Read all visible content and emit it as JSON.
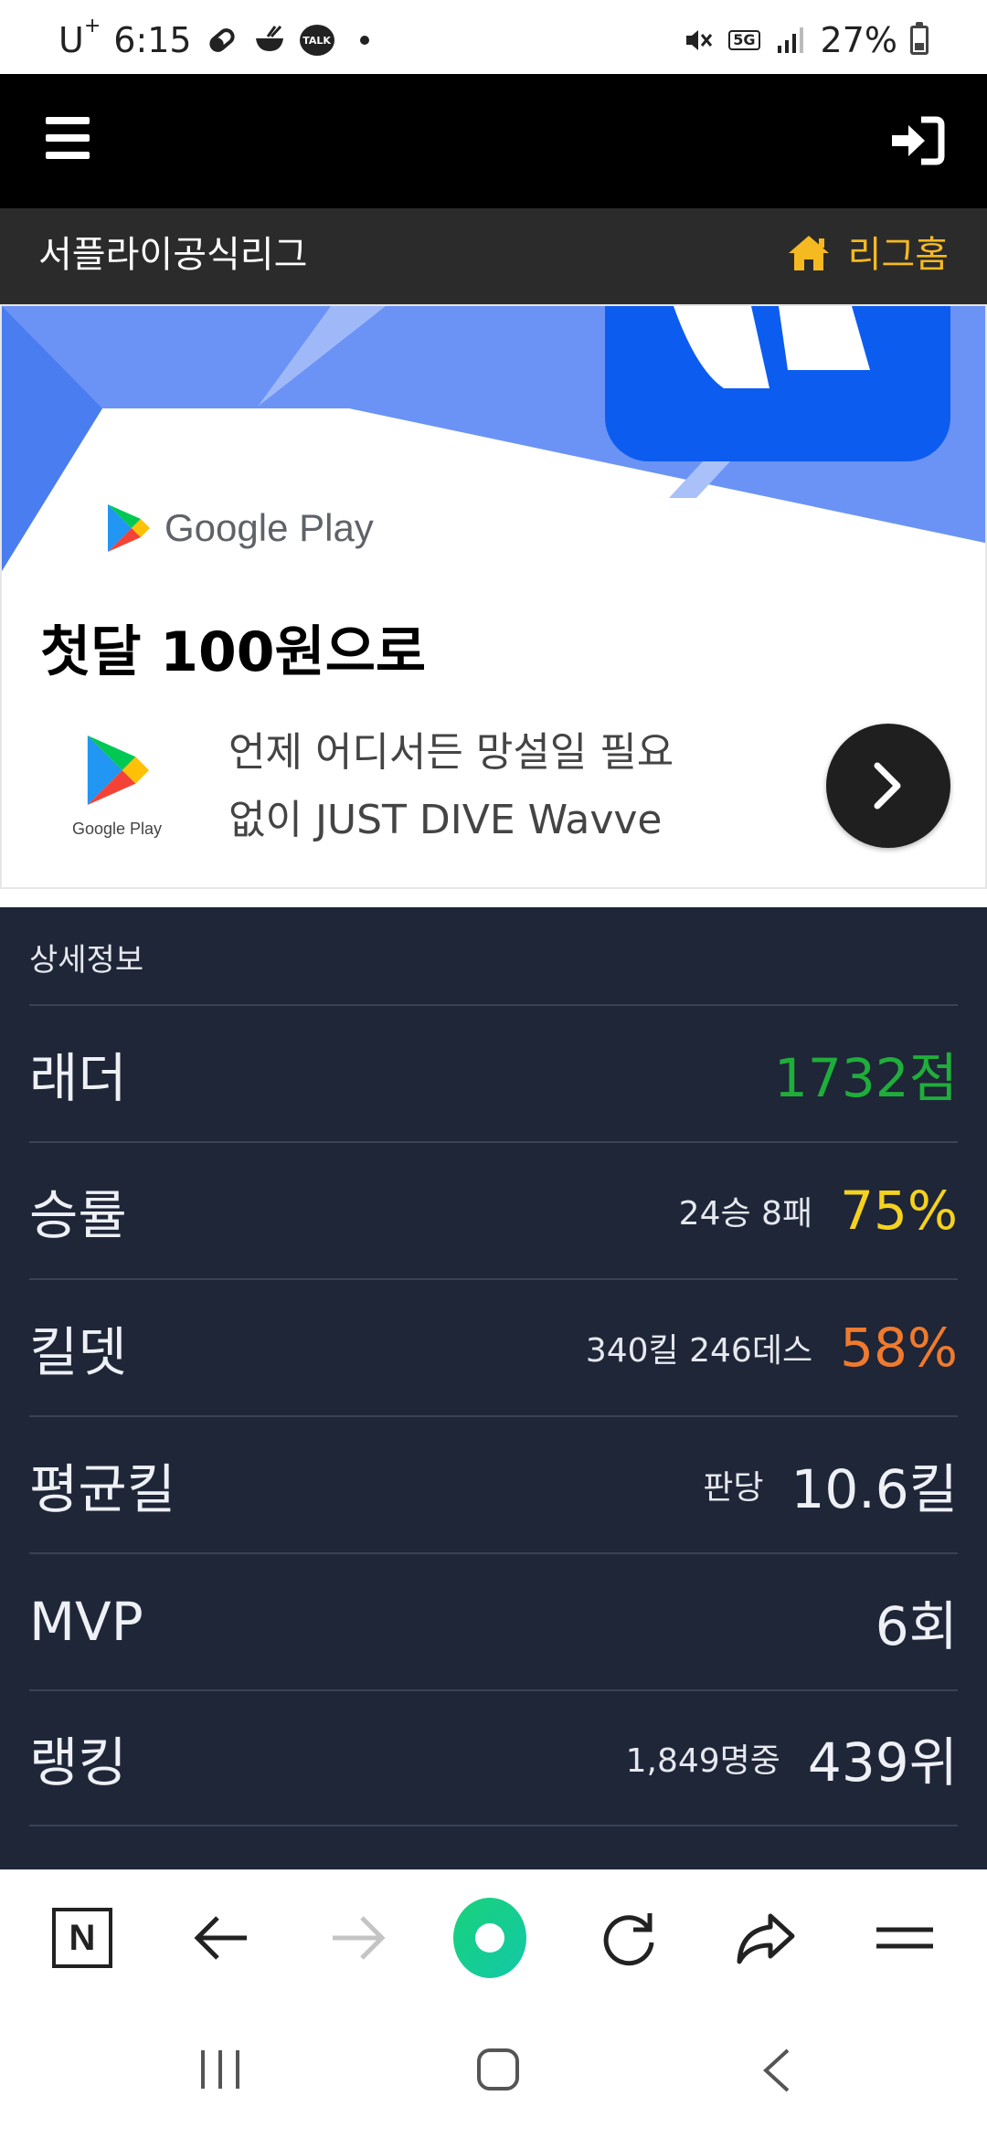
{
  "status_bar": {
    "carrier": "U",
    "carrier_sup": "+",
    "time": "6:15",
    "talk_badge": "TALK",
    "network": "5G",
    "battery": "27%"
  },
  "top_nav": {
    "menu_icon": "hamburger-icon",
    "login_icon": "sign-in-icon"
  },
  "league_bar": {
    "name": "서플라이공식리그",
    "home_label": "리그홈",
    "home_icon": "home-icon",
    "accent": "#f5b921"
  },
  "ad": {
    "store_name": "Google Play",
    "headline": "첫달 100원으로",
    "small_store_name": "Google Play",
    "description_line1": "언제 어디서든 망설일 필요",
    "description_line2": "없이 JUST DIVE Wavve",
    "next_icon": "chevron-right-icon"
  },
  "details": {
    "title": "상세정보",
    "rows": [
      {
        "label": "래더",
        "sub": "",
        "value": "1732점",
        "color": "#1fae3a"
      },
      {
        "label": "승률",
        "sub": "24승 8패",
        "value": "75%",
        "color": "#f5d21e"
      },
      {
        "label": "킬뎃",
        "sub": "340킬 246데스",
        "value": "58%",
        "color": "#f07a2e"
      },
      {
        "label": "평균킬",
        "sub": "판당",
        "value": "10.6킬",
        "color": "#eef0f5"
      },
      {
        "label": "MVP",
        "sub": "",
        "value": "6회",
        "color": "#eef0f5"
      },
      {
        "label": "랭킹",
        "sub": "1,849명중",
        "value": "439위",
        "color": "#eef0f5"
      }
    ]
  },
  "browser_toolbar": {
    "naver_label": "N",
    "items": [
      "naver-icon",
      "back-arrow-icon",
      "forward-arrow-icon",
      "home-icon",
      "refresh-icon",
      "share-icon",
      "menu-icon"
    ]
  },
  "android_nav": {
    "items": [
      "recents-icon",
      "home-icon",
      "back-icon"
    ]
  }
}
